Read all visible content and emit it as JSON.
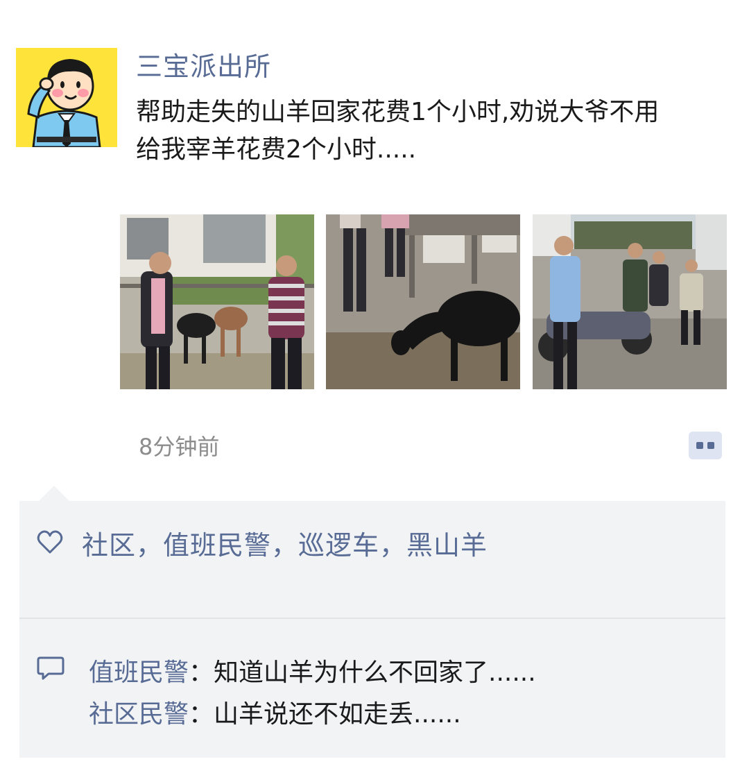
{
  "post": {
    "author": "三宝派出所",
    "text": "帮助走失的山羊回家花费1个小时,劝说大爷不用给我宰羊花费2个小时.....",
    "time": "8分钟前",
    "avatar_icon": "police-cartoon-avatar-icon",
    "photos": [
      {
        "icon": "photo-two-men-with-goats"
      },
      {
        "icon": "photo-black-goat-eating"
      },
      {
        "icon": "photo-people-in-yard"
      }
    ]
  },
  "likes": {
    "icon": "heart-icon",
    "text": "社区，值班民警，巡逻车，黑山羊"
  },
  "comments": [
    {
      "author": "值班民警",
      "separator": "：",
      "text": "知道山羊为什么不回家了......"
    },
    {
      "author": "社区民警",
      "separator": "：",
      "text": "山羊说还不如走丢......"
    }
  ],
  "colors": {
    "link": "#576b95",
    "panel_bg": "#f2f3f5",
    "avatar_bg": "#fde33a",
    "time": "#8c8c8c"
  }
}
